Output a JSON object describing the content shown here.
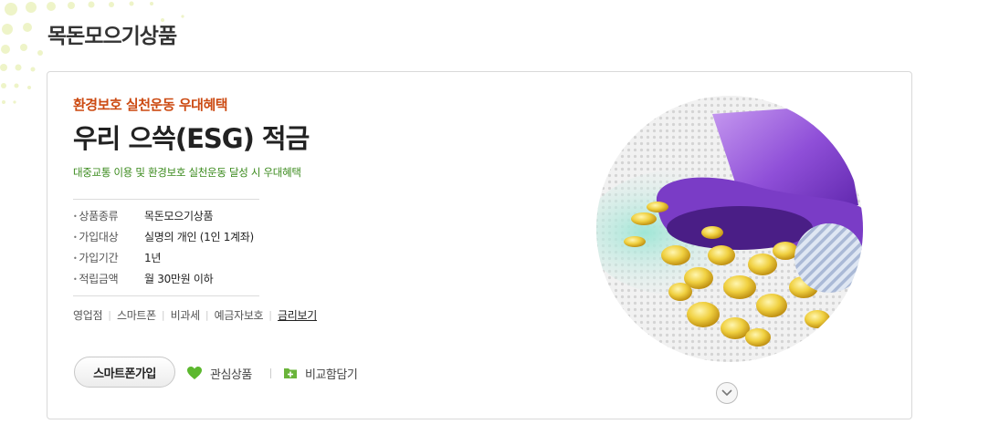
{
  "page": {
    "title": "목돈모으기상품"
  },
  "product": {
    "subtitle": "환경보호 실천운동 우대혜택",
    "name": "우리 으쓱(ESG) 적금",
    "description": "대중교통 이용 및 환경보호 실천운동 달성 시 우대혜택",
    "info": [
      {
        "label": "상품종류",
        "value": "목돈모으기상품"
      },
      {
        "label": "가입대상",
        "value": "실명의 개인 (1인 1계좌)"
      },
      {
        "label": "가입기간",
        "value": "1년"
      },
      {
        "label": "적립금액",
        "value": "월 30만원 이하"
      }
    ],
    "links": [
      "영업점",
      "스마트폰",
      "비과세",
      "예금자보호",
      "금리보기"
    ]
  },
  "actions": {
    "apply": "스마트폰가입",
    "favorite": "관심상품",
    "compare": "비교함담기"
  },
  "icons": {
    "favorite": "heart-icon",
    "compare": "folder-plus-icon",
    "scroll": "chevron-down-icon"
  },
  "colors": {
    "subtitle": "#cc4a12",
    "description": "#3a8a1c",
    "heart": "#5cb82e",
    "folder": "#6ab43a",
    "dots": "#e9f0b8"
  }
}
